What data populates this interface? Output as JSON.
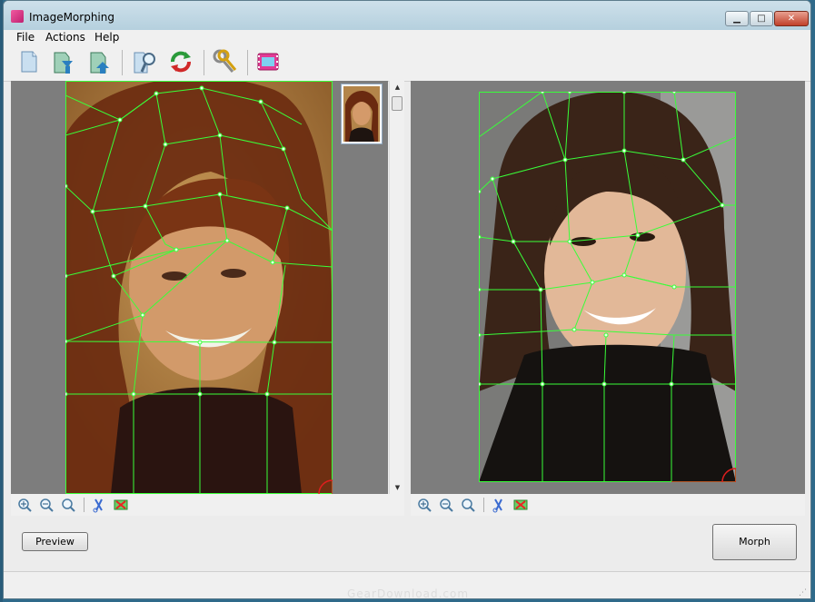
{
  "window": {
    "title": "ImageMorphing",
    "controls": {
      "minimize": "▁",
      "maximize": "□",
      "close": "✕"
    }
  },
  "menu": {
    "items": [
      {
        "label": "File"
      },
      {
        "label": "Actions"
      },
      {
        "label": "Help"
      }
    ]
  },
  "toolbar": {
    "buttons": [
      {
        "name": "new-document-icon"
      },
      {
        "name": "open-source-image-icon"
      },
      {
        "name": "open-target-image-icon"
      },
      {
        "name": "find-image-icon"
      },
      {
        "name": "refresh-icon"
      },
      {
        "name": "settings-keys-icon"
      },
      {
        "name": "export-movie-icon"
      }
    ]
  },
  "zoom_toolbar": {
    "icons": [
      "zoom-in-icon",
      "zoom-out-icon",
      "zoom-fit-icon",
      "cut-icon",
      "delete-points-icon"
    ]
  },
  "buttons": {
    "preview": "Preview",
    "morph": "Morph"
  },
  "watermark": "GearDownload.com",
  "colors": {
    "grid": "#39ff39",
    "corner_marker": "#e11e1e",
    "pane_bg": "#7d7d7d"
  }
}
